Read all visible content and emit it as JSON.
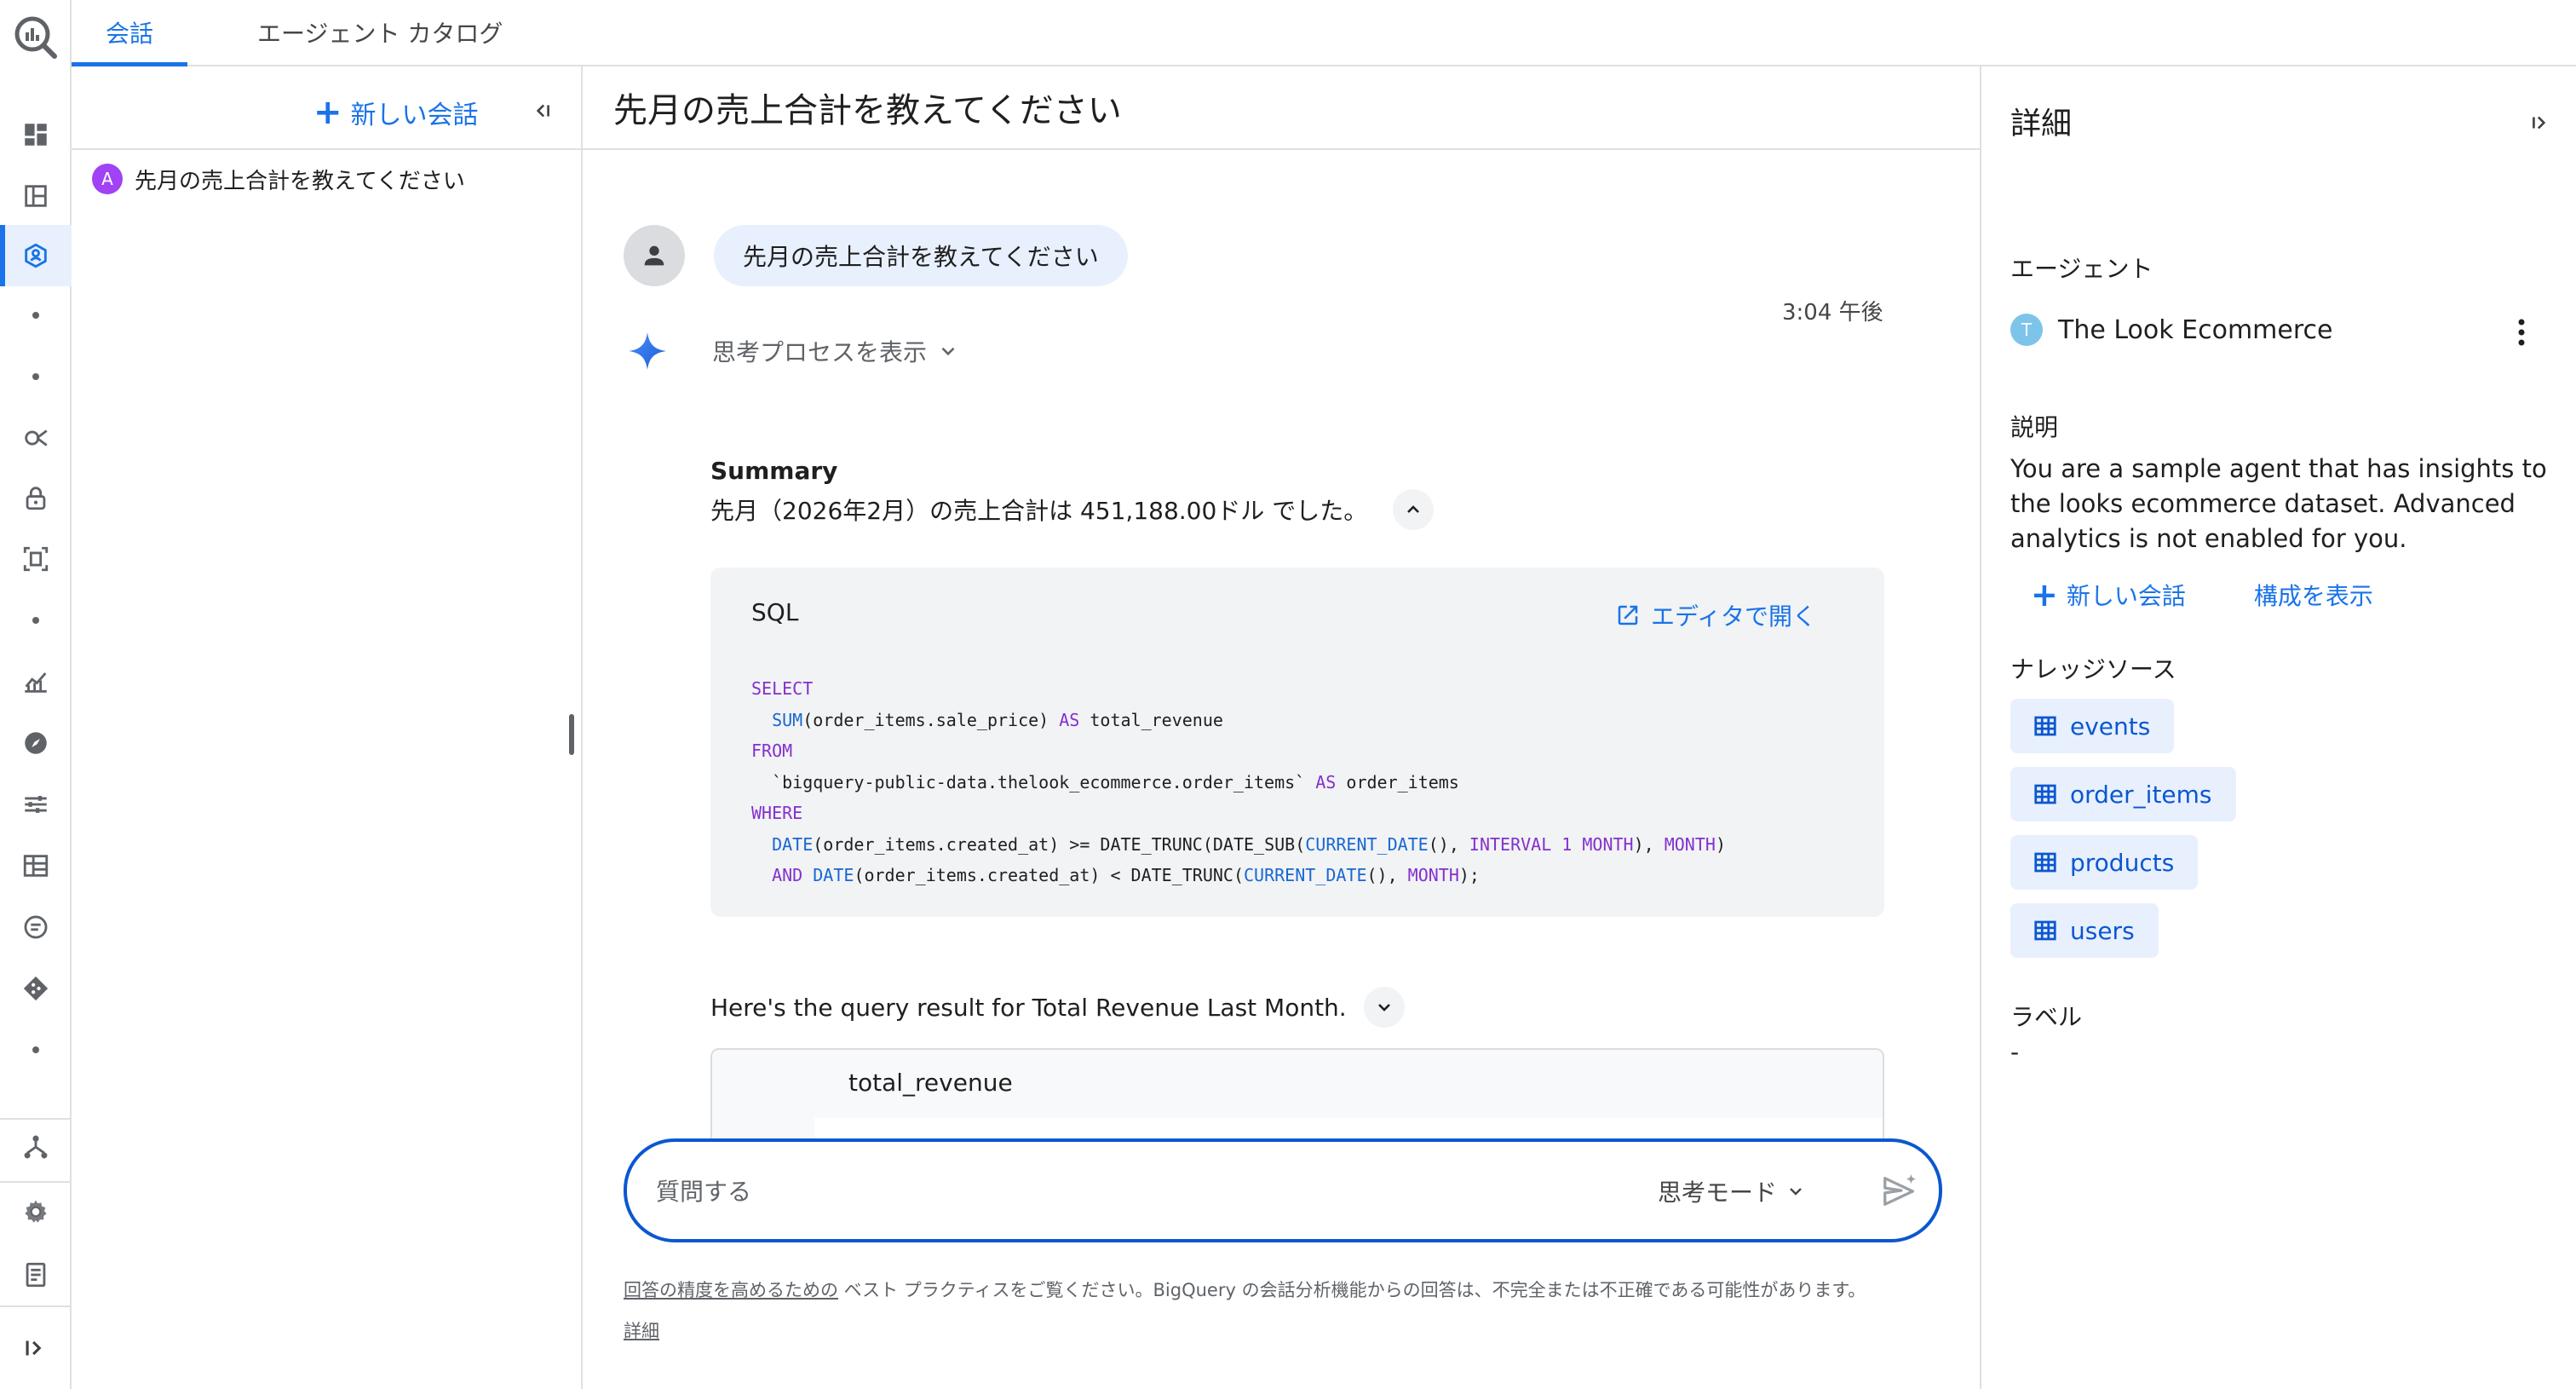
{
  "tabs": [
    {
      "label": "会話",
      "active": true
    },
    {
      "label": "エージェント カタログ",
      "active": false
    }
  ],
  "conversation_list": {
    "new_conversation_label": "新しい会話",
    "items": [
      {
        "avatar_letter": "A",
        "title": "先月の売上合計を教えてください"
      }
    ]
  },
  "main": {
    "title": "先月の売上合計を教えてください",
    "user_message": "先月の売上合計を教えてください",
    "message_time": "3:04 午後",
    "thinking_toggle_label": "思考プロセスを表示",
    "summary": {
      "heading": "Summary",
      "text": "先月（2026年2月）の売上合計は 451,188.00ドル でした。"
    },
    "sql": {
      "label": "SQL",
      "open_in_editor_label": "エディタで開く"
    },
    "result": {
      "text": "Here's the query result for Total Revenue Last Month.",
      "column_header": "total_revenue"
    },
    "composer": {
      "placeholder": "質問する",
      "mode_label": "思考モード"
    },
    "disclaimer": {
      "link_text": "回答の精度を高めるための",
      "text": " ベスト プラクティスをご覧ください。BigQuery の会話分析機能からの回答は、不完全または不正確である可能性があります。",
      "details_link": "詳細"
    }
  },
  "details": {
    "title": "詳細",
    "agent_section_label": "エージェント",
    "agent_avatar_letter": "T",
    "agent_name": "The Look Ecommerce",
    "description_label": "説明",
    "description": "You are a sample agent that has insights to the looks ecommerce dataset. Advanced analytics is not enabled for you.",
    "new_conversation_label": "新しい会話",
    "view_config_label": "構成を表示",
    "knowledge_sources_label": "ナレッジソース",
    "knowledge_sources": [
      "events",
      "order_items",
      "products",
      "users"
    ],
    "labels_label": "ラベル",
    "labels_value": "-"
  },
  "colors": {
    "accent": "#1a73e8",
    "chip_bg": "#e8f0fe",
    "composer_border": "#0b57d0",
    "user_avatar_letter_bg": "#a142f4",
    "agent_avatar_bg": "#7cc4ea"
  },
  "rail_icons": [
    "bigquery-logo-icon",
    "dashboard-icon",
    "layout-icon",
    "agent-hub-icon",
    "dot-icon",
    "dot-icon",
    "search-analytics-icon",
    "lock-icon",
    "scan-icon",
    "dot-icon",
    "chart-icon",
    "compass-icon",
    "tune-icon",
    "table-icon",
    "chat-icon",
    "git-icon",
    "dot-icon",
    "hierarchy-icon",
    "settings-icon",
    "release-notes-icon",
    "expand-icon"
  ]
}
